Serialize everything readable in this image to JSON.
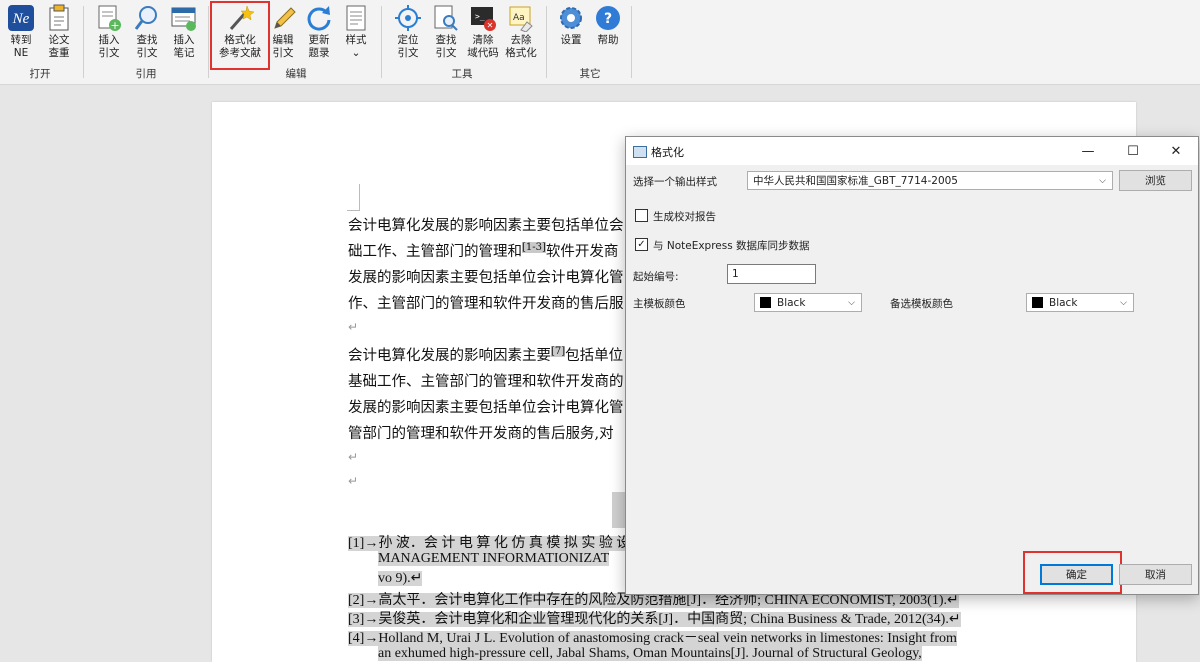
{
  "ribbon": {
    "buttons": [
      {
        "label1": "转到",
        "label2": "NE",
        "icon": "ne-logo-icon"
      },
      {
        "label1": "论文",
        "label2": "查重",
        "icon": "clipboard-check-icon"
      },
      {
        "label1": "插入",
        "label2": "引文",
        "icon": "insert-citation-icon"
      },
      {
        "label1": "查找",
        "label2": "引文",
        "icon": "find-citation-icon"
      },
      {
        "label1": "插入",
        "label2": "笔记",
        "icon": "insert-note-icon"
      },
      {
        "label1": "格式化",
        "label2": "参考文献",
        "icon": "magic-wand-icon"
      },
      {
        "label1": "编辑",
        "label2": "引文",
        "icon": "pencil-icon"
      },
      {
        "label1": "更新",
        "label2": "题录",
        "icon": "refresh-icon"
      },
      {
        "label1": "样式",
        "label2": "⌄",
        "icon": "style-icon"
      },
      {
        "label1": "定位",
        "label2": "引文",
        "icon": "locate-icon"
      },
      {
        "label1": "查找",
        "label2": "引文",
        "icon": "find-doc-icon"
      },
      {
        "label1": "清除",
        "label2": "域代码",
        "icon": "clear-field-code-icon"
      },
      {
        "label1": "去除",
        "label2": "格式化",
        "icon": "remove-format-icon"
      },
      {
        "label1": "设置",
        "label2": "",
        "icon": "gear-icon"
      },
      {
        "label1": "帮助",
        "label2": "",
        "icon": "help-icon"
      }
    ],
    "groups": [
      "打开",
      "引用",
      "编辑",
      "工具",
      "其它"
    ]
  },
  "document": {
    "p1": [
      "会计电算化发展的影响因素主要包括单位会",
      "础工作、主管部门的管理和",
      "软件开发商",
      "发展的影响因素主要包括单位会计电算化管",
      "作、主管部门的管理和软件开发商的售后服"
    ],
    "p1_cite": "[1-3]",
    "p2": [
      "会计电算化发展的影响因素主要",
      "包括单位",
      "基础工作、主管部门的管理和软件开发商的",
      "发展的影响因素主要包括单位会计电算化管",
      "管部门的管理和软件开发商的售后服务,对"
    ],
    "p2_cite": "[7]",
    "para_mark": "↵",
    "refs": [
      "[1]→孙 波．会 计 电 算 化 仿 真 模 拟 实 验 设",
      "MANAGEMENT INFORMATIONIZAT",
      "vo 9).↵",
      "[2]→高太平．会计电算化工作中存在的风险及防范措施[J]．经济师; CHINA ECONOMIST, 2003(1).↵",
      "[3]→吴俊英．会计电算化和企业管理现代化的关系[J]．中国商贸; China Business & Trade, 2012(34).↵",
      "[4]→Holland M, Urai J L. Evolution of anastomosing crack－seal vein networks in limestones: Insight from",
      "an exhumed high-pressure cell, Jabal Shams, Oman Mountains[J]. Journal of Structural Geology,"
    ]
  },
  "dialog": {
    "title": "格式化",
    "minimize": "—",
    "maximize": "☐",
    "close": "✕",
    "style_label": "选择一个输出样式",
    "style_value": "中华人民共和国国家标准_GBT_7714-2005",
    "browse": "浏览",
    "report_label": "生成校对报告",
    "report_checked": false,
    "sync_label": "与 NoteExpress 数据库同步数据",
    "sync_checked": true,
    "start_label": "起始编号:",
    "start_value": "1",
    "main_color_label": "主模板颜色",
    "main_color_value": "Black",
    "alt_color_label": "备选模板颜色",
    "alt_color_value": "Black",
    "ok": "确定",
    "cancel": "取消"
  },
  "colors": {
    "highlight": "#e0322f",
    "accent": "#0078d7"
  }
}
